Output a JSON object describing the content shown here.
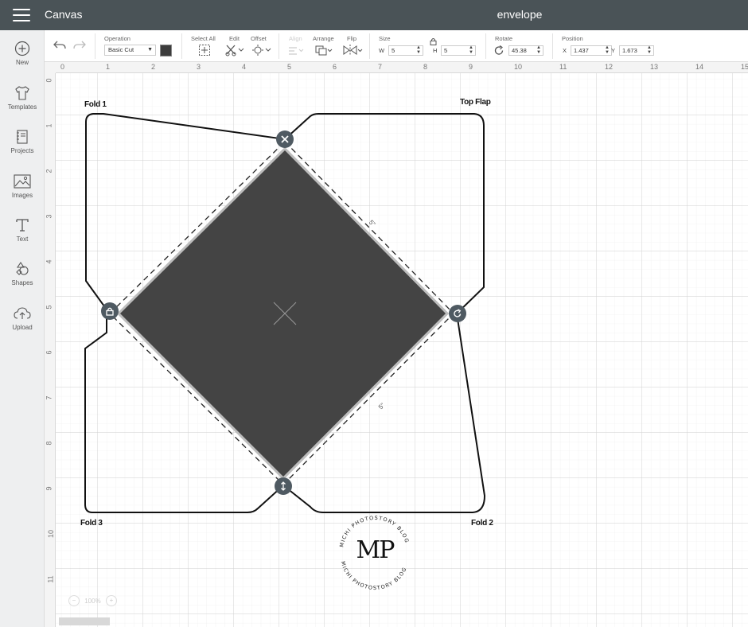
{
  "topbar": {
    "app_title": "Canvas",
    "doc_title": "envelope"
  },
  "sidebar": {
    "items": [
      {
        "label": "New",
        "icon": "plus-circle-icon"
      },
      {
        "label": "Templates",
        "icon": "tshirt-icon"
      },
      {
        "label": "Projects",
        "icon": "notebook-icon"
      },
      {
        "label": "Images",
        "icon": "image-icon"
      },
      {
        "label": "Text",
        "icon": "text-t-icon"
      },
      {
        "label": "Shapes",
        "icon": "shapes-icon"
      },
      {
        "label": "Upload",
        "icon": "cloud-upload-icon"
      }
    ]
  },
  "toolbar": {
    "operation_label": "Operation",
    "operation_value": "Basic Cut",
    "select_all_label": "Select All",
    "edit_label": "Edit",
    "offset_label": "Offset",
    "align_label": "Align",
    "arrange_label": "Arrange",
    "flip_label": "Flip",
    "size_label": "Size",
    "w_label": "W",
    "w_value": "5",
    "h_label": "H",
    "h_value": "5",
    "rotate_label": "Rotate",
    "rotate_value": "45.38",
    "position_label": "Position",
    "x_label": "X",
    "x_value": "1.437",
    "y_label": "Y",
    "y_value": "1.673",
    "swatch_color": "#3c3c3c"
  },
  "rulers": {
    "top": [
      "0",
      "1",
      "2",
      "3",
      "4",
      "5",
      "6",
      "7",
      "8",
      "9",
      "10",
      "11",
      "12",
      "13",
      "14",
      "15"
    ],
    "left": [
      "0",
      "1",
      "2",
      "3",
      "4",
      "5",
      "6",
      "7",
      "8",
      "9",
      "10",
      "11"
    ]
  },
  "canvas": {
    "fold_1": "Fold 1",
    "top_flap": "Top Flap",
    "fold_2": "Fold 2",
    "fold_3": "Fold 3",
    "dim_top": "5\"",
    "dim_bottom": "5\"",
    "logo_text": "MP",
    "logo_ring_text": "MICHI PHOTOSTORY BLOG",
    "zoom_value": "100%",
    "shape_fill": "#444444"
  }
}
